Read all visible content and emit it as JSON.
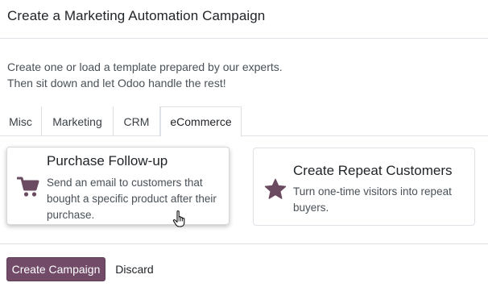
{
  "dialog": {
    "title": "Create a Marketing Automation Campaign",
    "intro_line1": "Create one or load a template prepared by our experts.",
    "intro_line2": "Then sit down and let Odoo handle the rest!"
  },
  "tabs": [
    {
      "label": "Misc",
      "active": false
    },
    {
      "label": "Marketing",
      "active": false
    },
    {
      "label": "CRM",
      "active": false
    },
    {
      "label": "eCommerce",
      "active": true
    }
  ],
  "cards": [
    {
      "title": "Purchase Follow-up",
      "description": "Send an email to customers that bought a specific product after their purchase.",
      "icon": "shopping-cart-icon"
    },
    {
      "title": "Create Repeat Customers",
      "description": "Turn one-time visitors into repeat buyers.",
      "icon": "star-icon"
    }
  ],
  "footer": {
    "primary_label": "Create Campaign",
    "secondary_label": "Discard"
  },
  "colors": {
    "brand": "#714b67",
    "icon": "#6b4b61"
  }
}
